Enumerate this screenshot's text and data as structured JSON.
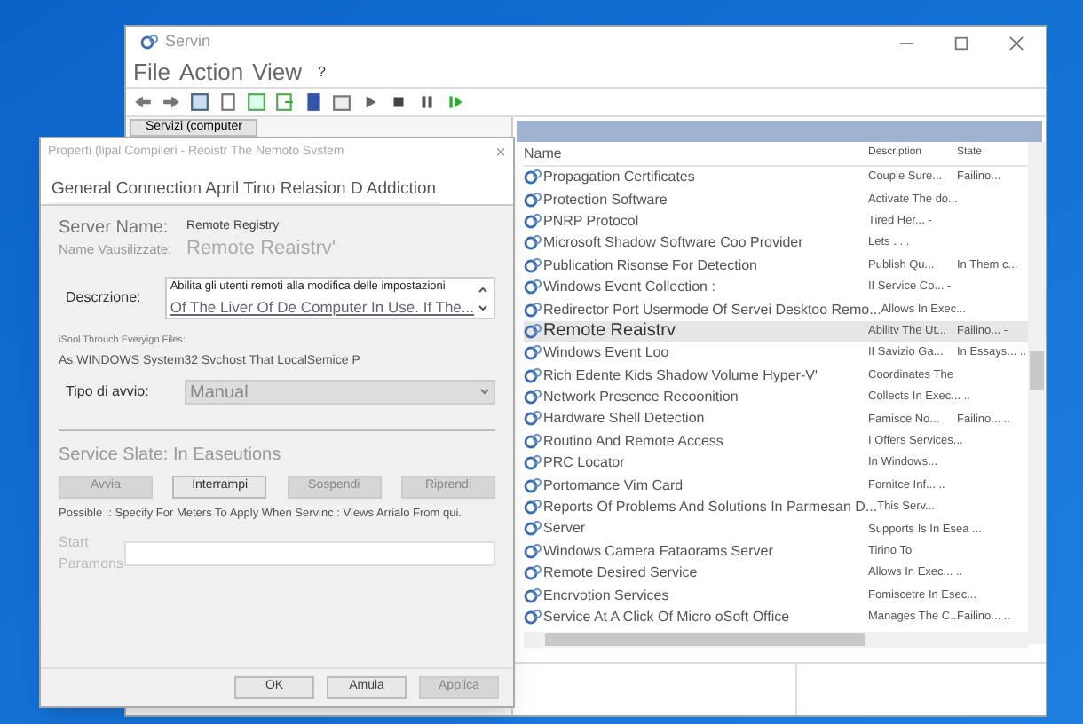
{
  "window": {
    "title": "Servin",
    "menu": [
      "File",
      "Action",
      "View",
      "?"
    ]
  },
  "tree": {
    "label": "Servizi (computer"
  },
  "table": {
    "columns": [
      "Name",
      "Description",
      "State"
    ],
    "rows": [
      {
        "name": "Propagation Certificates",
        "description": "Couple Sure...",
        "state": "Failino...",
        "selected": false
      },
      {
        "name": "Protection Software",
        "description": "Activate The do...",
        "selected": false
      },
      {
        "name": "PNRP Protocol",
        "description": "Tired Her... -",
        "selected": false
      },
      {
        "name": "Microsoft Shadow Software Coo Provider",
        "description": "Lets . . .",
        "selected": false
      },
      {
        "name": "Publication Risonse For Detection",
        "description": "Publish Qu...",
        "state": "In Them c...",
        "selected": false
      },
      {
        "name": "Windows Event Collection :",
        "description": "II Service Co... -",
        "selected": false
      },
      {
        "name": "Redirector Port Usermode Of Servei Desktoo Remo...",
        "description": "Allows In Exec...",
        "selected": false
      },
      {
        "name": "Remote Reaistrv",
        "description": "Abilitv The Ut...",
        "state": "Failino... -",
        "selected": true
      },
      {
        "name": "Windows Event Loo",
        "description": "II Savizio Ga...",
        "state": "In Essays... ..",
        "selected": false
      },
      {
        "name": "Rich Edente Kids Shadow Volume Hyper-V'",
        "description": "Coordinates The",
        "selected": false
      },
      {
        "name": "Network Presence Recoonition",
        "description": "Collects In Exec... ..",
        "selected": false
      },
      {
        "name": "Hardware Shell Detection",
        "description": "Famisce No...",
        "state": "Failino... ..",
        "selected": false
      },
      {
        "name": "Routino And Remote Access",
        "description": "I Offers Services...",
        "selected": false
      },
      {
        "name": "PRC Locator",
        "description": "In Windows...",
        "selected": false
      },
      {
        "name": "Portomance Vim Card",
        "description": "Fornitce Inf... ..",
        "selected": false
      },
      {
        "name": "Reports Of Problems And Solutions In Parmesan D...",
        "description": "This Serv...",
        "selected": false
      },
      {
        "name": "Server",
        "description": "Supports Is In Esea ...",
        "selected": false
      },
      {
        "name": "Windows Camera Fataorams Server",
        "description": "Tirino To",
        "selected": false
      },
      {
        "name": "Remote Desired Service",
        "description": "Allows In Exec... ..",
        "selected": false
      },
      {
        "name": "Encrvotion Services",
        "description": "Fomiscetre In Esec...",
        "selected": false
      },
      {
        "name": "Service At A Click Of Micro oSoft Office",
        "description": "Manages The C...",
        "state": "Failino... ..",
        "selected": false
      }
    ]
  },
  "dialog": {
    "title": "Properti (lipal Compileri - Reoistr The Nemoto Svstem",
    "close": "×",
    "tabs": [
      {
        "label": "General Connection April Tino Relasion D Addiction",
        "selected": true
      }
    ],
    "fields": [
      {
        "label": "Server Name:",
        "value": "Remote Registry"
      },
      {
        "label": "Name Vausilizzate:",
        "value": "Remote Reaistrv'"
      }
    ],
    "description": {
      "label": "Descrzione:",
      "lines": [
        "Abilita gli utenti remoti alla modifica delle impostazioni",
        "Of The Liver Of De Computer In Use. If The..."
      ]
    },
    "path": {
      "label": "iSool Throuch Everyign Files:",
      "value": "As WINDOWS System32 Svchost That LocalSemice P"
    },
    "startup": {
      "label": "Tipo di avvio:",
      "value": "Manual"
    },
    "service_state": "Service Slate: In Easeutions",
    "buttons": [
      {
        "label": "Avvia",
        "disabled": true
      },
      {
        "label": "Interrampi",
        "disabled": false
      },
      {
        "label": "Sospendi",
        "disabled": true
      },
      {
        "label": "Riprendi",
        "disabled": true
      }
    ],
    "hint": "Possible :: Specify For Meters To Apply When Servinc : Views Arrialo From qui.",
    "start_params": {
      "label": "Start Paramons"
    },
    "footer": [
      {
        "label": "OK",
        "disabled": false
      },
      {
        "label": "Amula",
        "disabled": false
      },
      {
        "label": "Applica",
        "disabled": true
      }
    ]
  }
}
